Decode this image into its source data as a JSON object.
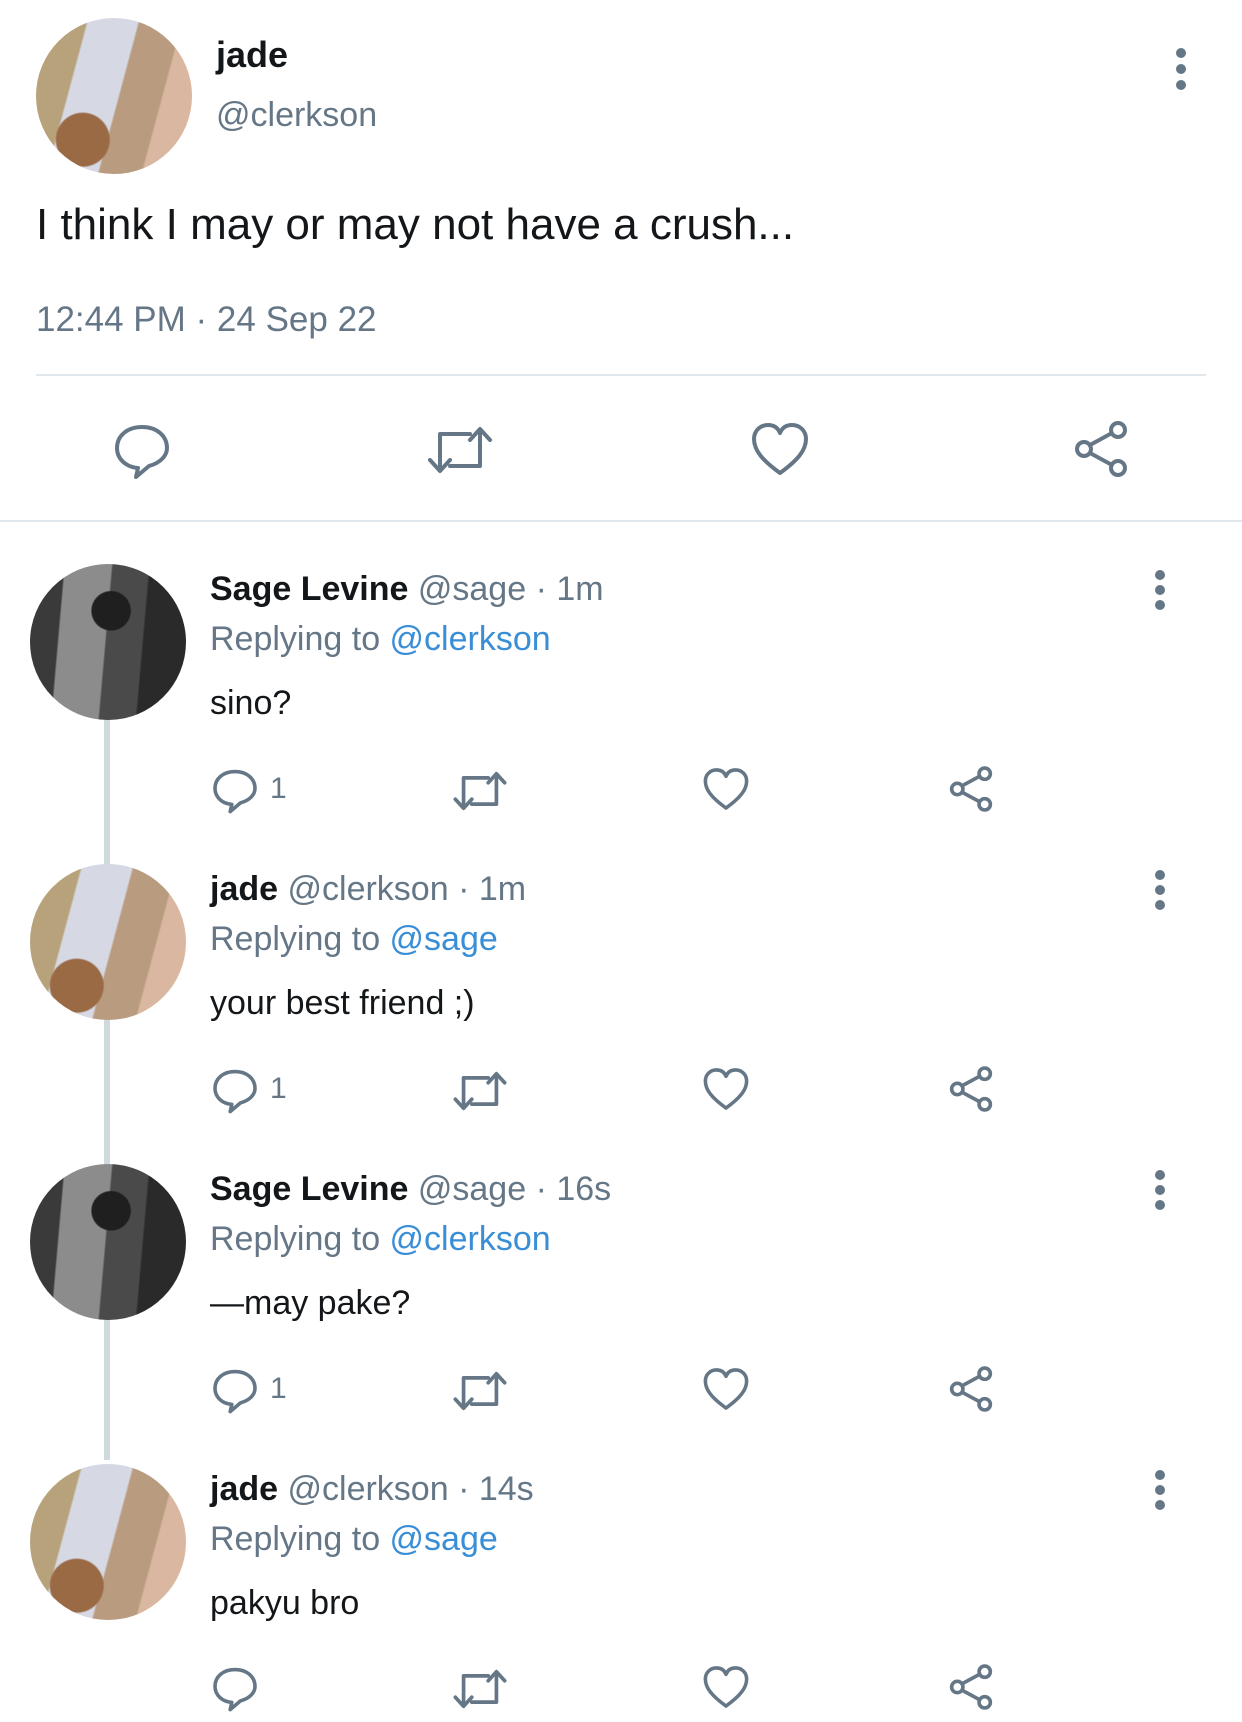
{
  "main_tweet": {
    "author_name": "jade",
    "author_handle": "@clerkson",
    "text": "I think I may or may not have a crush...",
    "timestamp": "12:44 PM · 24 Sep 22"
  },
  "icons": {
    "reply": "speech-bubble-icon",
    "retweet": "retweet-icon",
    "like": "heart-icon",
    "share": "share-icon",
    "more": "vertical-ellipsis-icon"
  },
  "colors": {
    "link": "#3a8ed6",
    "muted": "#657786",
    "text": "#14171a"
  },
  "replies": [
    {
      "name": "Sage Levine",
      "meta": "@sage · 1m",
      "replying_prefix": "Replying to ",
      "replying_to": "@clerkson",
      "text": "sino?",
      "reply_count": "1"
    },
    {
      "name": "jade",
      "meta": "@clerkson · 1m",
      "replying_prefix": "Replying to ",
      "replying_to": "@sage",
      "text": "your best friend ;)",
      "reply_count": "1"
    },
    {
      "name": "Sage Levine",
      "meta": "@sage · 16s",
      "replying_prefix": "Replying to ",
      "replying_to": "@clerkson",
      "text": "—may pake?",
      "reply_count": "1"
    },
    {
      "name": "jade",
      "meta": "@clerkson · 14s",
      "replying_prefix": "Replying to ",
      "replying_to": "@sage",
      "text": "pakyu bro",
      "reply_count": ""
    }
  ]
}
